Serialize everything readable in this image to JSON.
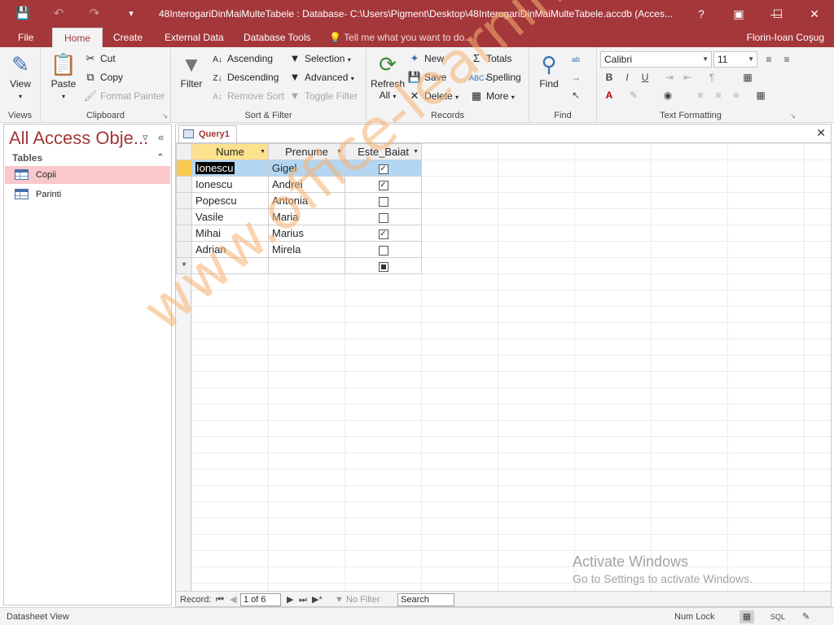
{
  "titlebar": {
    "title": "48InterogariDinMaiMulteTabele : Database- C:\\Users\\Pigment\\Desktop\\48InterogariDinMaiMulteTabele.accdb (Acces...",
    "help": "?"
  },
  "tabs": [
    "File",
    "Home",
    "Create",
    "External Data",
    "Database Tools"
  ],
  "tellme": "Tell me what you want to do...",
  "user": "Florin-Ioan Coşug",
  "ribbon": {
    "views": {
      "view": "View",
      "label": "Views"
    },
    "clipboard": {
      "paste": "Paste",
      "cut": "Cut",
      "copy": "Copy",
      "format_painter": "Format Painter",
      "label": "Clipboard"
    },
    "sortfilter": {
      "filter": "Filter",
      "ascending": "Ascending",
      "descending": "Descending",
      "remove_sort": "Remove Sort",
      "selection": "Selection",
      "advanced": "Advanced",
      "toggle_filter": "Toggle Filter",
      "label": "Sort & Filter"
    },
    "records": {
      "refresh": "Refresh",
      "all": "All",
      "new": "New",
      "save": "Save",
      "delete": "Delete",
      "totals": "Totals",
      "spelling": "Spelling",
      "more": "More",
      "label": "Records"
    },
    "find": {
      "find": "Find",
      "label": "Find"
    },
    "text": {
      "font": "Calibri",
      "size": "11",
      "bold": "B",
      "italic": "I",
      "underline": "U",
      "label": "Text Formatting"
    }
  },
  "nav": {
    "title": "All Access Obje...",
    "section": "Tables",
    "items": [
      "Copii",
      "Parinti"
    ]
  },
  "doc": {
    "tab": "Query1",
    "columns": [
      "Nume",
      "Prenume",
      "Este_Baiat"
    ],
    "rows": [
      {
        "nume": "Ionescu",
        "prenume": "Gigel",
        "baiat": true
      },
      {
        "nume": "Ionescu",
        "prenume": "Andrei",
        "baiat": true
      },
      {
        "nume": "Popescu",
        "prenume": "Antonia",
        "baiat": false
      },
      {
        "nume": "Vasile",
        "prenume": "Maria",
        "baiat": false
      },
      {
        "nume": "Mihai",
        "prenume": "Marius",
        "baiat": true
      },
      {
        "nume": "Adrian",
        "prenume": "Mirela",
        "baiat": false
      }
    ],
    "new_row_marker": "*"
  },
  "recordnav": {
    "label": "Record:",
    "position": "1 of 6",
    "filter": "No Filter",
    "search": "Search"
  },
  "status": {
    "left": "Datasheet View",
    "numlock": "Num Lock",
    "sql": "SQL"
  },
  "watermark": "www.office-learning.ro",
  "activate": {
    "line1": "Activate Windows",
    "line2": "Go to Settings to activate Windows."
  }
}
